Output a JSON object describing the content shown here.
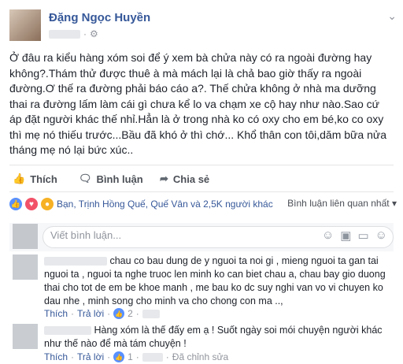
{
  "post": {
    "author": "Đặng Ngọc Huyền",
    "text": "Ở đâu ra kiểu hàng xóm soi để ý xem bà chửa này có ra ngoài đường hay không?.Thám thử được thuê à mà mách lại là chả bao giờ thấy ra ngoài đường.Ơ thế ra đường phải báo cáo a?. Thế chửa không ở nhà ma dưỡng thai ra đường lấm làm cái gì chưa kể lo va chạm xe cộ hay như nào.Sao cứ áp đặt người khác thế nhỉ.Hẳn là ở trong nhà ko có oxy cho em bé,ko co oxy thì mẹ nó thiếu trước...Bầu đã khó ở thì chớ... Khổ thân con tôi,dăm bữa nửa tháng mẹ nó lại bức xúc.."
  },
  "actions": {
    "like": "Thích",
    "comment": "Bình luận",
    "share": "Chia sẻ"
  },
  "reactions": {
    "summary": "Bạn, Trịnh Hồng Quế, Quế Vân và 2,5K người khác",
    "ranking": "Bình luận liên quan nhất"
  },
  "comment_box": {
    "placeholder": "Viết bình luận..."
  },
  "comments": [
    {
      "text": "chau co bau dung de y nguoi ta noi gi , mieng nguoi ta gan tai nguoi ta , nguoi ta nghe truoc len minh ko can biet chau a, chau bay gio duong thai cho tot de em be khoe manh , me bau ko dc suy nghi van vo vi chuyen ko dau nhe , minh song cho minh va cho chong con ma ..,",
      "like": "Thích",
      "reply": "Trả lời",
      "likes": "2"
    },
    {
      "text": "Hàng xóm là thế đấy em ạ ! Suốt ngày soi mói chuyện người khác như thế nào để mà tám chuyện !",
      "like": "Thích",
      "reply": "Trả lời",
      "likes": "1",
      "edited": "Đã chỉnh sửa"
    }
  ],
  "colors": {
    "link": "#365899",
    "like_blue": "#5890ff",
    "love_red": "#f25268"
  }
}
